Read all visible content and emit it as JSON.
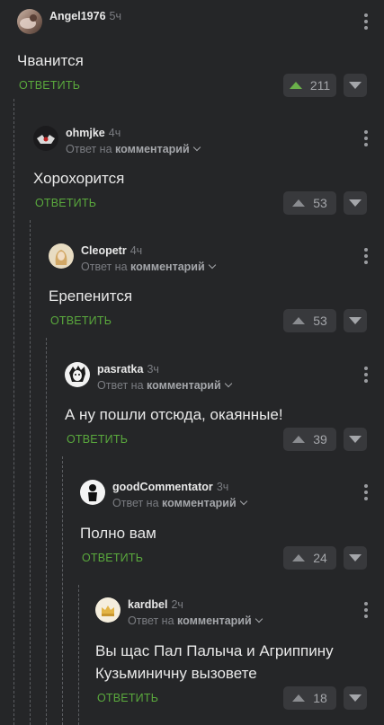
{
  "comments": [
    {
      "author": "Angel1976",
      "time": "5ч",
      "reply_to": "",
      "text": "Чванится",
      "reply_label": "ОТВЕТИТЬ",
      "score": "211",
      "hot": true,
      "avatar_icon": "user-avatar-icon"
    },
    {
      "author": "ohmjke",
      "time": "4ч",
      "reply_to": "Ответ на",
      "reply_target": "комментарий",
      "text": "Хорохорится",
      "reply_label": "ОТВЕТИТЬ",
      "score": "53",
      "hot": false,
      "avatar_icon": "user-avatar-icon"
    },
    {
      "author": "Cleopetr",
      "time": "4ч",
      "reply_to": "Ответ на",
      "reply_target": "комментарий",
      "text": "Ерепенится",
      "reply_label": "ОТВЕТИТЬ",
      "score": "53",
      "hot": false,
      "avatar_icon": "user-avatar-icon"
    },
    {
      "author": "pasratka",
      "time": "3ч",
      "reply_to": "Ответ на",
      "reply_target": "комментарий",
      "text": "А ну пошли отсюда, окаянные!",
      "reply_label": "ОТВЕТИТЬ",
      "score": "39",
      "hot": false,
      "avatar_icon": "user-avatar-icon"
    },
    {
      "author": "goodCommentator",
      "time": "3ч",
      "reply_to": "Ответ на",
      "reply_target": "комментарий",
      "text": "Полно вам",
      "reply_label": "ОТВЕТИТЬ",
      "score": "24",
      "hot": false,
      "avatar_icon": "user-avatar-icon"
    },
    {
      "author": "kardbel",
      "time": "2ч",
      "reply_to": "Ответ на",
      "reply_target": "комментарий",
      "text_lines": [
        "Вы щас Пал Палыча и Агриппину",
        "Кузьминичну вызовете"
      ],
      "reply_label": "ОТВЕТИТЬ",
      "score": "18",
      "hot": false,
      "avatar_icon": "user-avatar-icon"
    }
  ],
  "icons": {
    "upvote": "triangle-up-icon",
    "downvote": "triangle-down-icon",
    "menu": "kebab-menu-icon",
    "expand": "chevron-down-icon"
  },
  "colors": {
    "background": "#252628",
    "accent": "#5aa93d",
    "upvote_hot": "#6ab04a"
  }
}
